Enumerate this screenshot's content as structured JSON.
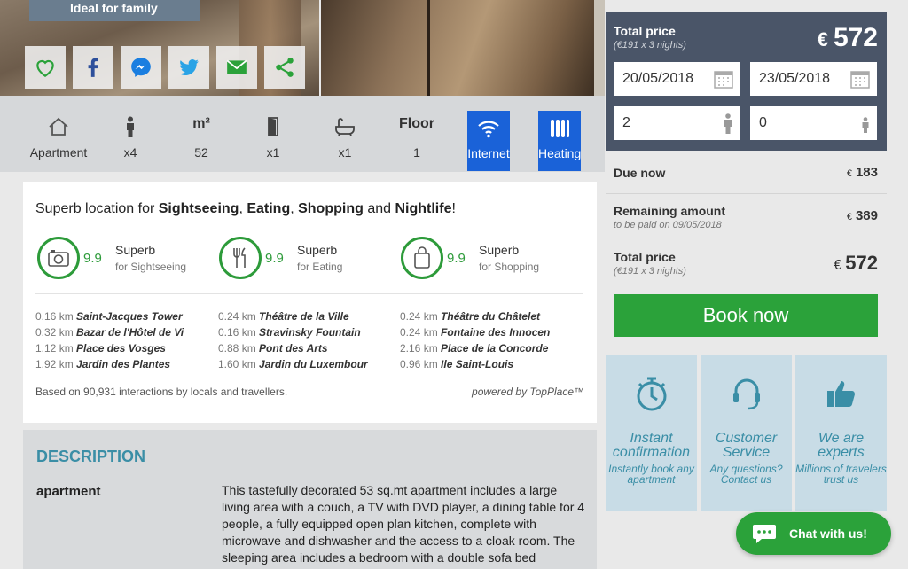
{
  "gallery": {
    "badge": "Ideal for family"
  },
  "share": [
    "favorite-icon",
    "facebook-icon",
    "messenger-icon",
    "twitter-icon",
    "email-icon",
    "share-icon"
  ],
  "features": [
    {
      "icon": "house-icon",
      "value": "Apartment"
    },
    {
      "icon": "person-icon",
      "value": "x4"
    },
    {
      "label": "m²",
      "value": "52"
    },
    {
      "icon": "door-icon",
      "value": "x1"
    },
    {
      "icon": "bathtub-icon",
      "value": "x1"
    },
    {
      "label": "Floor",
      "value": "1"
    },
    {
      "icon": "wifi-icon",
      "value": "Internet"
    },
    {
      "icon": "radiator-icon",
      "value": "Heating"
    }
  ],
  "location": {
    "headline_prefix": "Superb location for ",
    "headline_items": [
      "Sightseeing",
      "Eating",
      "Shopping",
      "Nightlife"
    ],
    "sep1": ", ",
    "sep2": ", ",
    "sep3": " and ",
    "headline_suffix": "!",
    "scores": [
      {
        "icon": "camera-icon",
        "score": "9.9",
        "label": "Superb",
        "sub": "for Sightseeing"
      },
      {
        "icon": "cutlery-icon",
        "score": "9.9",
        "label": "Superb",
        "sub": "for Eating"
      },
      {
        "icon": "bag-icon",
        "score": "9.9",
        "label": "Superb",
        "sub": "for Shopping"
      }
    ],
    "places": [
      [
        {
          "d": "0.16 km",
          "n": "Saint-Jacques Tower"
        },
        {
          "d": "0.32 km",
          "n": "Bazar de l'Hôtel de Vi"
        },
        {
          "d": "1.12 km",
          "n": "Place des Vosges"
        },
        {
          "d": "1.92 km",
          "n": "Jardin des Plantes"
        }
      ],
      [
        {
          "d": "0.24 km",
          "n": "Théâtre de la Ville"
        },
        {
          "d": "0.16 km",
          "n": "Stravinsky Fountain"
        },
        {
          "d": "0.88 km",
          "n": "Pont des Arts"
        },
        {
          "d": "1.60 km",
          "n": "Jardin du Luxembour"
        }
      ],
      [
        {
          "d": "0.24 km",
          "n": "Théâtre du Châtelet"
        },
        {
          "d": "0.24 km",
          "n": "Fontaine des Innocen"
        },
        {
          "d": "2.16 km",
          "n": "Place de la Concorde"
        },
        {
          "d": "0.96 km",
          "n": "Ile Saint-Louis"
        }
      ]
    ],
    "footnote": "Based on 90,931 interactions by locals and travellers.",
    "powered": "powered by TopPlace™"
  },
  "description": {
    "title": "DESCRIPTION",
    "type": "apartment",
    "text": "This tastefully decorated 53 sq.mt apartment includes a large living area with a couch, a TV with DVD player, a dining table for 4 people, a fully equipped open plan kitchen, complete with microwave and dishwasher and the access to a cloak room. The sleeping area includes a bedroom with a double sofa bed"
  },
  "booking": {
    "title": "Total price",
    "sub": "(€191 x 3 nights)",
    "currency": "€",
    "price": "572",
    "checkin": "20/05/2018",
    "checkout": "23/05/2018",
    "adults": "2",
    "children": "0",
    "due_label": "Due now",
    "due_value": "183",
    "remaining_label": "Remaining amount",
    "remaining_sub": "to be paid on 09/05/2018",
    "remaining_value": "389",
    "total_label": "Total price",
    "total_sub": "(€191 x 3 nights)",
    "total_value": "572",
    "book_label": "Book now"
  },
  "perks": [
    {
      "icon": "stopwatch-icon",
      "title": "Instant confirmation",
      "sub": "Instantly book any apartment"
    },
    {
      "icon": "headset-icon",
      "title": "Customer Service",
      "sub": "Any questions? Contact us"
    },
    {
      "icon": "thumbs-up-icon",
      "title": "We are experts",
      "sub": "Millions of travelers trust us"
    }
  ],
  "chat": {
    "label": "Chat with us!"
  },
  "colors": {
    "green": "#2ba23a",
    "blue": "#1a62d8",
    "teal": "#3a8ea6",
    "panel": "#4a5568"
  }
}
